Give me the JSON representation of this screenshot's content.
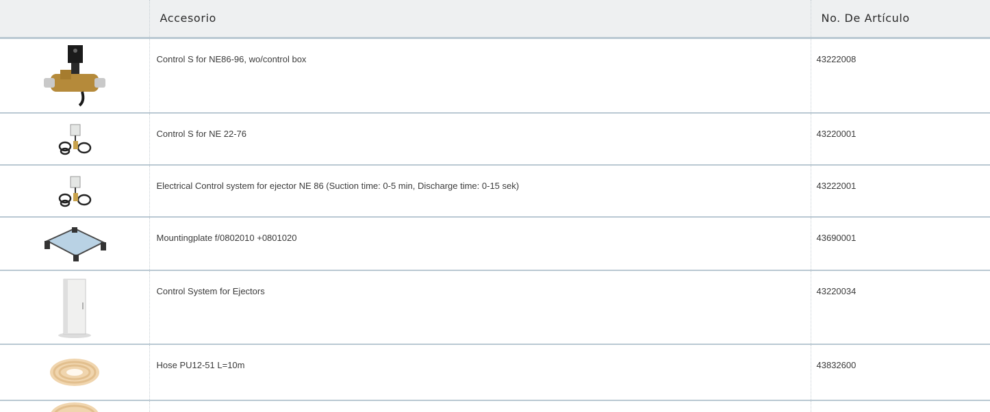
{
  "table": {
    "headers": {
      "image": "",
      "accessory": "Accesorio",
      "article_number": "No. De Artículo"
    },
    "rows": [
      {
        "image_icon": "valve-control-icon",
        "name": "Control S for NE86-96, wo/control box",
        "article_number": "43222008"
      },
      {
        "image_icon": "control-cable-icon",
        "name": "Control S for NE 22-76",
        "article_number": "43220001"
      },
      {
        "image_icon": "control-cable-icon",
        "name": "Electrical Control system for ejector NE 86 (Suction time: 0-5 min, Discharge time: 0-15 sek)",
        "article_number": "43222001"
      },
      {
        "image_icon": "mounting-plate-icon",
        "name": "Mountingplate f/0802010 +0801020",
        "article_number": "43690001"
      },
      {
        "image_icon": "cabinet-icon",
        "name": "Control System for Ejectors",
        "article_number": "43220034"
      },
      {
        "image_icon": "hose-coil-icon",
        "name": "Hose PU12-51 L=10m",
        "article_number": "43832600"
      },
      {
        "image_icon": "hose-coil-icon",
        "name": "",
        "article_number": ""
      }
    ]
  },
  "colors": {
    "header_bg": "#eef0f1",
    "row_border": "#b9c8d2",
    "text": "#3a3a3a"
  }
}
